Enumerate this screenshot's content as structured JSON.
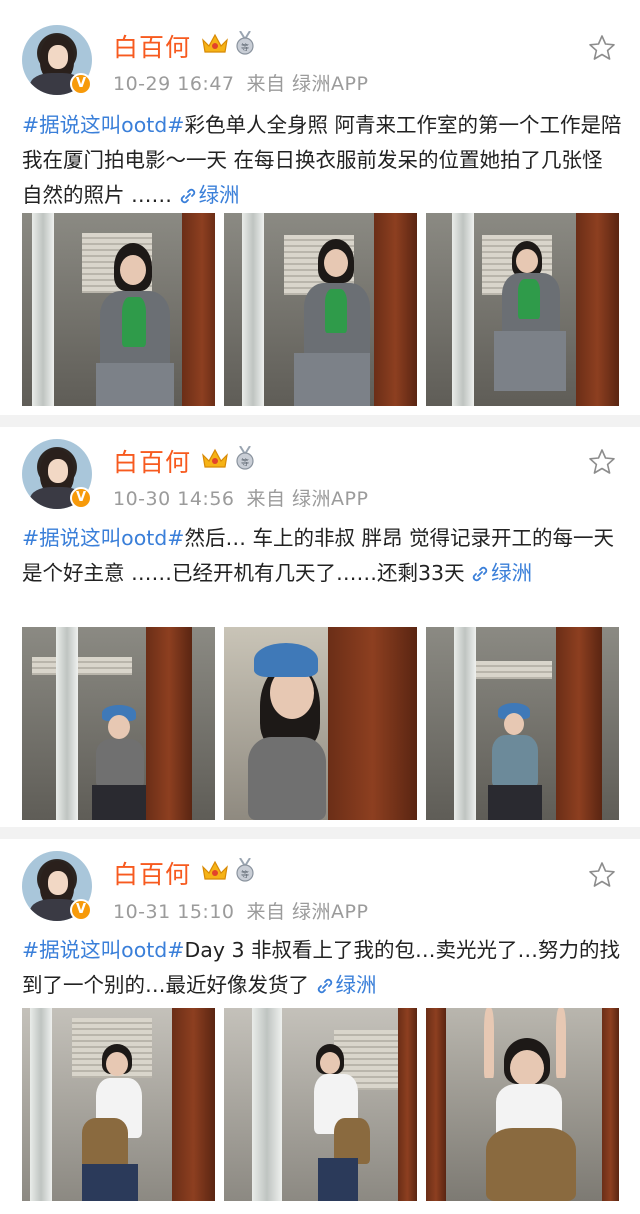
{
  "posts": [
    {
      "username": "白百何",
      "verified_badge": "V",
      "date": "10-29 16:47",
      "source": "来自 绿洲APP",
      "hashtag": "#据说这叫ootd#",
      "text": "彩色单人全身照 阿青来工作室的第一个工作是陪我在厦门拍电影～一天 在每日换衣服前发呆的位置她拍了几张怪自然的照片 ……",
      "link_label": "绿洲",
      "icons": [
        "crown-icon",
        "medal-icon",
        "star-icon",
        "link-icon"
      ]
    },
    {
      "username": "白百何",
      "verified_badge": "V",
      "date": "10-30 14:56",
      "source": "来自 绿洲APP",
      "hashtag": "#据说这叫ootd#",
      "text": "然后… 车上的非叔 胖昂 觉得记录开工的每一天是个好主意 ……已经开机有几天了……还剩33天",
      "link_label": "绿洲",
      "icons": [
        "crown-icon",
        "medal-icon",
        "star-icon",
        "link-icon"
      ]
    },
    {
      "username": "白百何",
      "verified_badge": "V",
      "date": "10-31 15:10",
      "source": "来自 绿洲APP",
      "hashtag": "#据说这叫ootd#",
      "text": "Day 3 非叔看上了我的包…卖光光了…努力的找到了一个别的…最近好像发货了",
      "link_label": "绿洲",
      "icons": [
        "crown-icon",
        "medal-icon",
        "star-icon",
        "link-icon"
      ]
    }
  ],
  "colors": {
    "username": "#f75a1f",
    "link": "#3a7fd9",
    "meta": "#9b9b9b",
    "badge": "#f79a0a"
  }
}
